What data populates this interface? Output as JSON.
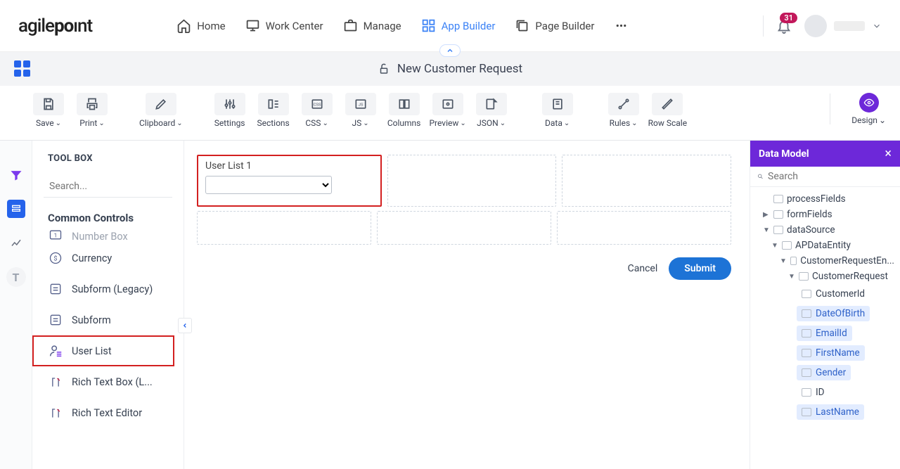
{
  "topnav": {
    "logo_a": "agile",
    "logo_b": "po",
    "logo_c": "ı",
    "logo_d": "nt",
    "items": [
      {
        "label": "Home"
      },
      {
        "label": "Work Center"
      },
      {
        "label": "Manage"
      },
      {
        "label": "App Builder"
      },
      {
        "label": "Page Builder"
      }
    ],
    "notifications": "31"
  },
  "page_title": "New Customer Request",
  "toolbar": {
    "save": "Save",
    "print": "Print",
    "clipboard": "Clipboard",
    "settings": "Settings",
    "sections": "Sections",
    "css": "CSS",
    "js": "JS",
    "columns": "Columns",
    "preview": "Preview",
    "json": "JSON",
    "data": "Data",
    "rules": "Rules",
    "rowscale": "Row Scale",
    "design": "Design"
  },
  "toolbox": {
    "title": "TOOL BOX",
    "search_placeholder": "Search...",
    "section": "Common Controls",
    "items": [
      "Number Box",
      "Currency",
      "Subform (Legacy)",
      "Subform",
      "User List",
      "Rich Text Box (L...",
      "Rich Text Editor"
    ]
  },
  "canvas": {
    "field_label": "User List 1",
    "cancel": "Cancel",
    "submit": "Submit"
  },
  "datamodel": {
    "title": "Data Model",
    "search_placeholder": "Search",
    "nodes": {
      "processFields": "processFields",
      "formFields": "formFields",
      "dataSource": "dataSource",
      "apdata": "APDataEntity",
      "crEntity": "CustomerRequestEn...",
      "cr": "CustomerRequest",
      "leaves": [
        "CustomerId",
        "DateOfBirth",
        "EmailId",
        "FirstName",
        "Gender",
        "ID",
        "LastName"
      ]
    }
  }
}
